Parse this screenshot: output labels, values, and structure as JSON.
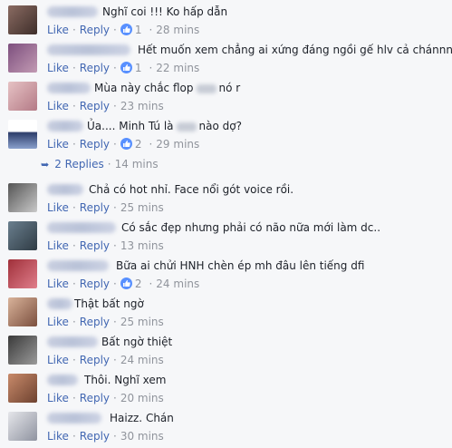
{
  "common": {
    "like": "Like",
    "reply": "Reply",
    "sep": "·"
  },
  "comments": [
    {
      "text": "Nghĩ coi !!! Ko hấp dẫn",
      "likes": "1",
      "time": "28 mins"
    },
    {
      "text": "Hết muốn xem chẳng ai xứng đáng ngồi gế hlv cả chánnn",
      "likes": "1",
      "time": "22 mins"
    },
    {
      "text_before": "Mùa này chắc flop",
      "text_after": "nó r",
      "time": "23 mins"
    },
    {
      "text_before": "Ủa.... Minh Tú là",
      "text_after": "nào dợ?",
      "likes": "2",
      "time": "29 mins"
    },
    {
      "text": "Chả có hot nhỉ. Face nổi gót voice rồi.",
      "time": "25 mins"
    },
    {
      "text": "Có sắc đẹp nhưng phải có não nữa mới làm dc..",
      "time": "13 mins"
    },
    {
      "text": "Bữa ai chửi HNH chèn ép mh đâu lên tiếng dfi",
      "likes": "2",
      "time": "24 mins"
    },
    {
      "text": "Thật bất ngờ",
      "time": "25 mins"
    },
    {
      "text": "Bất ngờ thiệt",
      "time": "24 mins"
    },
    {
      "text": "Thôi. Nghĩ xem",
      "time": "20 mins"
    },
    {
      "text": "Haizz. Chán",
      "time": "30 mins"
    }
  ],
  "replies": {
    "label": "2 Replies",
    "time": "14 mins"
  },
  "colors": {
    "link": "#4267b2",
    "meta": "#90949c",
    "like_badge": "#5890ff",
    "background": "#f6f7f9"
  }
}
